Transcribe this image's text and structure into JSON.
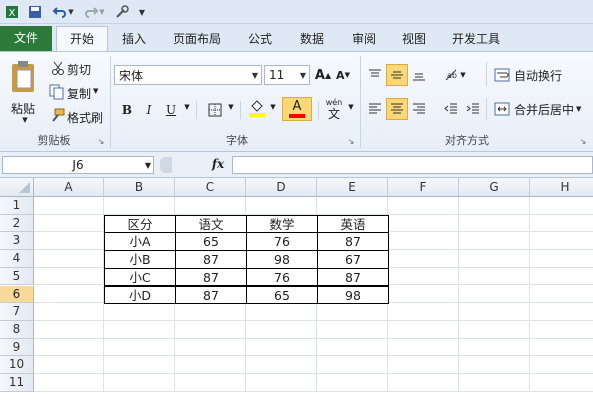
{
  "tabs": [
    {
      "label": "文件"
    },
    {
      "label": "开始"
    },
    {
      "label": "插入"
    },
    {
      "label": "页面布局"
    },
    {
      "label": "公式"
    },
    {
      "label": "数据"
    },
    {
      "label": "审阅"
    },
    {
      "label": "视图"
    },
    {
      "label": "开发工具"
    }
  ],
  "clipboard": {
    "paste": "粘贴",
    "cut": "剪切",
    "copy": "复制",
    "format_painter": "格式刷",
    "group": "剪贴板"
  },
  "font": {
    "name": "宋体",
    "size": "11",
    "bold": "B",
    "italic": "I",
    "underline": "U",
    "group": "字体",
    "fill_color": "#ffff00",
    "font_color": "#ff0000",
    "phonetic": "wén"
  },
  "alignment": {
    "wrap_text": "自动换行",
    "merge_center": "合并后居中",
    "group": "对齐方式"
  },
  "formula_bar": {
    "name_box": "J6",
    "fx": "fx",
    "formula": ""
  },
  "sheet": {
    "columns": [
      "A",
      "B",
      "C",
      "D",
      "E",
      "F",
      "G",
      "H"
    ],
    "rows": [
      "1",
      "2",
      "3",
      "4",
      "5",
      "6",
      "7",
      "8",
      "9",
      "10",
      "11"
    ],
    "selected_row": "6",
    "table": [
      [
        "区分",
        "语文",
        "数学",
        "英语"
      ],
      [
        "小A",
        "65",
        "76",
        "87"
      ],
      [
        "小B",
        "87",
        "98",
        "67"
      ],
      [
        "小C",
        "87",
        "76",
        "87"
      ],
      [
        "小D",
        "87",
        "65",
        "98"
      ]
    ]
  }
}
